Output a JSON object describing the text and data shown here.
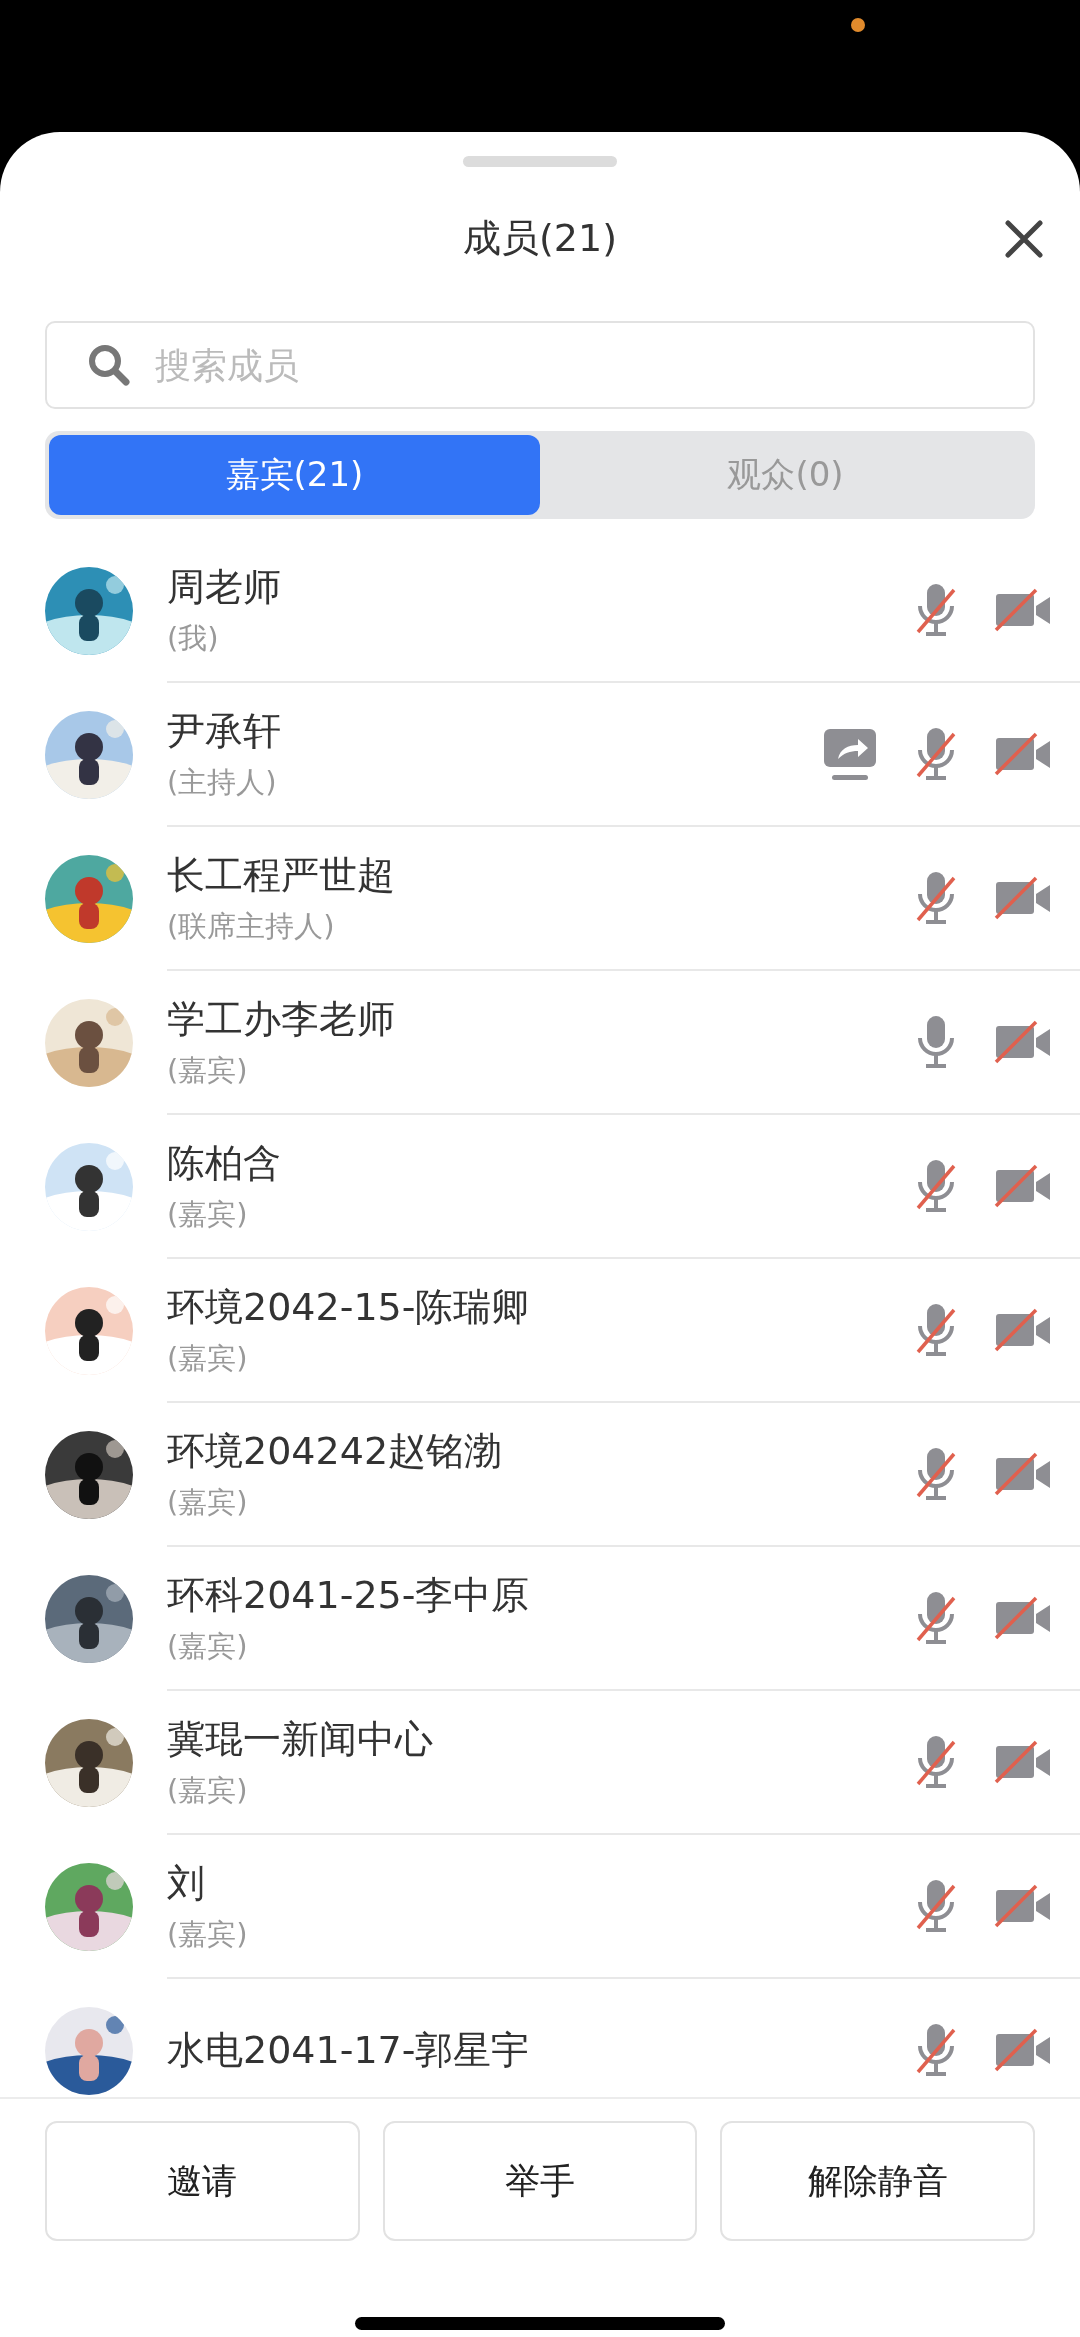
{
  "sheet": {
    "title": "成员(21)"
  },
  "search": {
    "placeholder": "搜索成员"
  },
  "tabs": [
    {
      "label": "嘉宾(21)",
      "selected": true
    },
    {
      "label": "观众(0)",
      "selected": false
    }
  ],
  "members": [
    {
      "name": "周老师",
      "role": "(我)",
      "sharing": false,
      "mic_muted": true,
      "camera_off": true
    },
    {
      "name": "尹承轩",
      "role": "(主持人)",
      "sharing": true,
      "mic_muted": true,
      "camera_off": true
    },
    {
      "name": "长工程严世超",
      "role": "(联席主持人)",
      "sharing": false,
      "mic_muted": true,
      "camera_off": true
    },
    {
      "name": "学工办李老师",
      "role": "(嘉宾)",
      "sharing": false,
      "mic_muted": false,
      "camera_off": true
    },
    {
      "name": "陈柏含",
      "role": "(嘉宾)",
      "sharing": false,
      "mic_muted": true,
      "camera_off": true
    },
    {
      "name": "环境2042-15-陈瑞卿",
      "role": "(嘉宾)",
      "sharing": false,
      "mic_muted": true,
      "camera_off": true
    },
    {
      "name": "环境204242赵铭渤",
      "role": "(嘉宾)",
      "sharing": false,
      "mic_muted": true,
      "camera_off": true
    },
    {
      "name": "环科2041-25-李中原",
      "role": "(嘉宾)",
      "sharing": false,
      "mic_muted": true,
      "camera_off": true
    },
    {
      "name": "冀琨一新闻中心",
      "role": "(嘉宾)",
      "sharing": false,
      "mic_muted": true,
      "camera_off": true
    },
    {
      "name": "刘",
      "role": "(嘉宾)",
      "sharing": false,
      "mic_muted": true,
      "camera_off": true
    },
    {
      "name": "水电2041-17-郭星宇",
      "sharing": false,
      "mic_muted": true,
      "camera_off": true
    }
  ],
  "buttons": [
    "邀请",
    "举手",
    "解除静音"
  ]
}
